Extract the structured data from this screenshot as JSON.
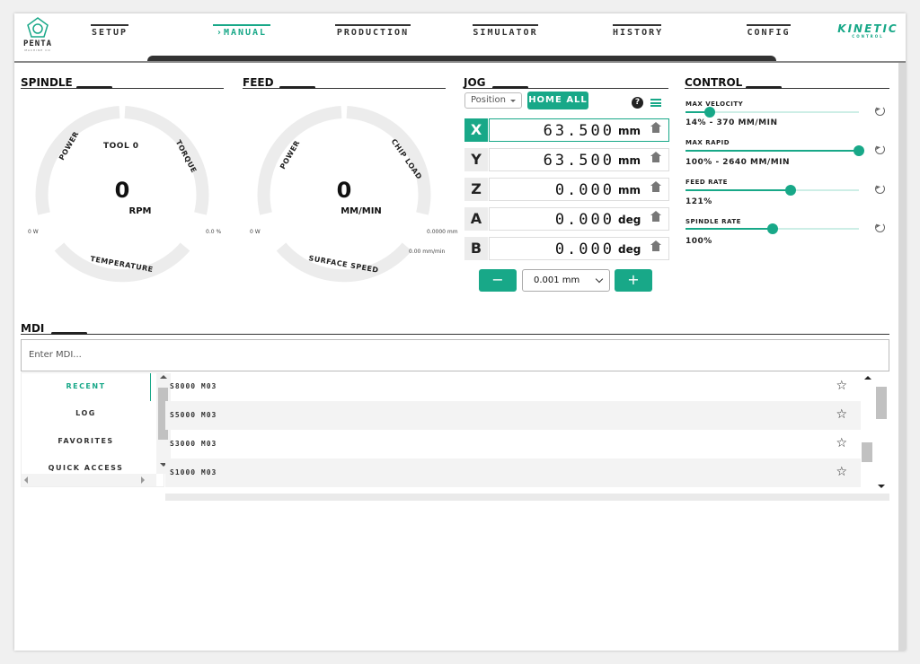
{
  "nav": {
    "logo": {
      "name": "PENTA",
      "sub": "MACHINE CO"
    },
    "items": [
      "SETUP",
      "MANUAL",
      "PRODUCTION",
      "SIMULATOR",
      "HISTORY",
      "CONFIG"
    ],
    "active": "MANUAL",
    "brand": {
      "title": "KINETIC",
      "sub": "CONTROL"
    }
  },
  "spindle": {
    "title": "SPINDLE",
    "tool": "TOOL 0",
    "value": "0",
    "unit": "RPM",
    "labels": {
      "left": "POWER",
      "right": "TORQUE",
      "bottom": "TEMPERATURE"
    },
    "min_left": "0 W",
    "min_right": "0.0 %"
  },
  "feed": {
    "title": "FEED",
    "value": "0",
    "unit": "MM/MIN",
    "labels": {
      "left": "POWER",
      "right": "CHIP LOAD",
      "bottom": "SURFACE SPEED"
    },
    "min_left": "0 W",
    "min_right": "0.0000 mm",
    "min_bottom": "0.00 mm/min"
  },
  "jog": {
    "title": "JOG",
    "mode": "Position",
    "home_all": "HOME ALL",
    "help": "?",
    "axes": [
      {
        "axis": "X",
        "value": "63.500",
        "unit": "mm",
        "selected": true
      },
      {
        "axis": "Y",
        "value": "63.500",
        "unit": "mm",
        "selected": false
      },
      {
        "axis": "Z",
        "value": "0.000",
        "unit": "mm",
        "selected": false
      },
      {
        "axis": "A",
        "value": "0.000",
        "unit": "deg",
        "selected": false
      },
      {
        "axis": "B",
        "value": "0.000",
        "unit": "deg",
        "selected": false
      }
    ],
    "minus": "−",
    "plus": "+",
    "step": "0.001 mm"
  },
  "control": {
    "title": "CONTROL",
    "sliders": [
      {
        "label": "MAX VELOCITY",
        "value": "14% - 370 MM/MIN",
        "level": 0.14
      },
      {
        "label": "MAX RAPID",
        "value": "100% - 2640 MM/MIN",
        "level": 1.0
      },
      {
        "label": "FEED RATE",
        "value": "121%",
        "level": 0.605
      },
      {
        "label": "SPINDLE RATE",
        "value": "100%",
        "level": 0.5
      }
    ]
  },
  "mdi": {
    "title": "MDI",
    "placeholder": "Enter MDI...",
    "tabs": [
      "RECENT",
      "LOG",
      "FAVORITES",
      "QUICK ACCESS"
    ],
    "active_tab": "RECENT",
    "commands": [
      "S8000 M03",
      "S5000 M03",
      "S3000 M03",
      "S1000 M03"
    ]
  },
  "colors": {
    "accent": "#18a888",
    "gauge_track": "#ececec"
  }
}
